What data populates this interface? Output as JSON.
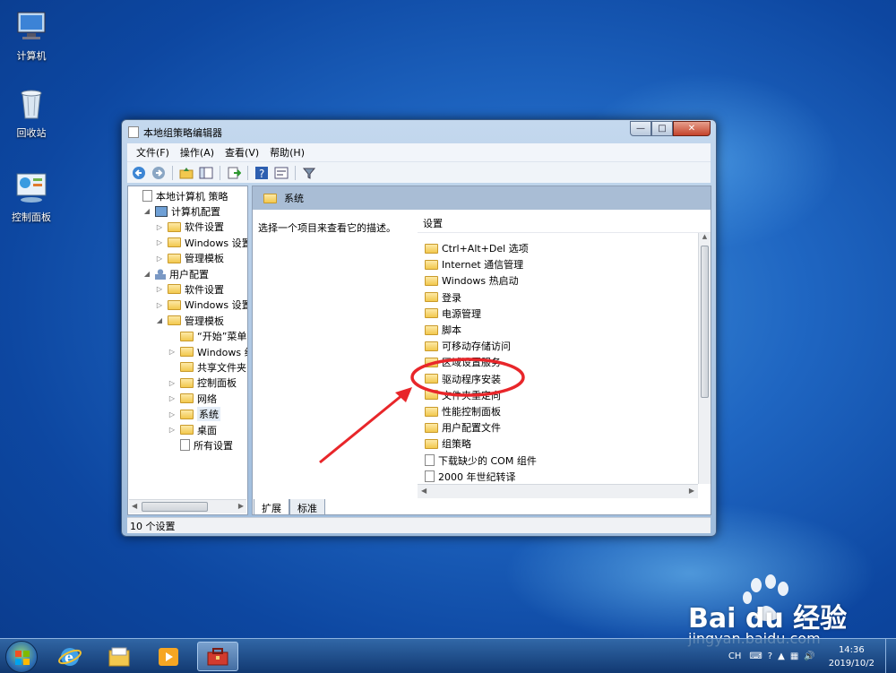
{
  "desktop": {
    "icons": [
      {
        "label": "计算机",
        "icon": "computer-icon"
      },
      {
        "label": "回收站",
        "icon": "recycle-bin-icon"
      },
      {
        "label": "控制面板",
        "icon": "control-panel-icon"
      }
    ]
  },
  "window": {
    "title": "本地组策略编辑器",
    "menu": [
      "文件(F)",
      "操作(A)",
      "查看(V)",
      "帮助(H)"
    ],
    "toolbar_icons": [
      "back-icon",
      "forward-icon",
      "up-folder-icon",
      "show-hide-tree-icon",
      "export-icon",
      "help-icon",
      "properties-icon",
      "filter-icon"
    ],
    "tree": [
      {
        "label": "本地计算机 策略",
        "indent": 0,
        "twisty": "",
        "icon": "doc"
      },
      {
        "label": "计算机配置",
        "indent": 1,
        "twisty": "◢",
        "icon": "pc"
      },
      {
        "label": "软件设置",
        "indent": 2,
        "twisty": "▷",
        "icon": "folder"
      },
      {
        "label": "Windows 设置",
        "indent": 2,
        "twisty": "▷",
        "icon": "folder"
      },
      {
        "label": "管理模板",
        "indent": 2,
        "twisty": "▷",
        "icon": "folder"
      },
      {
        "label": "用户配置",
        "indent": 1,
        "twisty": "◢",
        "icon": "user"
      },
      {
        "label": "软件设置",
        "indent": 2,
        "twisty": "▷",
        "icon": "folder"
      },
      {
        "label": "Windows 设置",
        "indent": 2,
        "twisty": "▷",
        "icon": "folder"
      },
      {
        "label": "管理模板",
        "indent": 2,
        "twisty": "◢",
        "icon": "folder"
      },
      {
        "label": "“开始”菜单",
        "indent": 3,
        "twisty": "",
        "icon": "folder"
      },
      {
        "label": "Windows 组",
        "indent": 3,
        "twisty": "▷",
        "icon": "folder"
      },
      {
        "label": "共享文件夹",
        "indent": 3,
        "twisty": "",
        "icon": "folder"
      },
      {
        "label": "控制面板",
        "indent": 3,
        "twisty": "▷",
        "icon": "folder"
      },
      {
        "label": "网络",
        "indent": 3,
        "twisty": "▷",
        "icon": "folder"
      },
      {
        "label": "系统",
        "indent": 3,
        "twisty": "▷",
        "icon": "folder",
        "selected": true
      },
      {
        "label": "桌面",
        "indent": 3,
        "twisty": "▷",
        "icon": "folder"
      },
      {
        "label": "所有设置",
        "indent": 3,
        "twisty": "",
        "icon": "doc"
      }
    ],
    "right": {
      "header": "系统",
      "description": "选择一个项目来查看它的描述。",
      "list_header": "设置",
      "items": [
        {
          "label": "Ctrl+Alt+Del 选项",
          "icon": "folder"
        },
        {
          "label": "Internet 通信管理",
          "icon": "folder"
        },
        {
          "label": "Windows 热启动",
          "icon": "folder"
        },
        {
          "label": "登录",
          "icon": "folder"
        },
        {
          "label": "电源管理",
          "icon": "folder"
        },
        {
          "label": "脚本",
          "icon": "folder"
        },
        {
          "label": "可移动存储访问",
          "icon": "folder"
        },
        {
          "label": "区域设置服务",
          "icon": "folder"
        },
        {
          "label": "驱动程序安装",
          "icon": "folder"
        },
        {
          "label": "文件夹重定向",
          "icon": "folder"
        },
        {
          "label": "性能控制面板",
          "icon": "folder"
        },
        {
          "label": "用户配置文件",
          "icon": "folder"
        },
        {
          "label": "组策略",
          "icon": "folder"
        },
        {
          "label": "下载缺少的 COM 组件",
          "icon": "doc"
        },
        {
          "label": "2000 年世纪转译",
          "icon": "doc"
        }
      ]
    },
    "tabs": [
      "扩展",
      "标准"
    ],
    "status": "10 个设置"
  },
  "taskbar": {
    "apps": [
      "internet-explorer-icon",
      "explorer-folder-icon",
      "media-player-icon",
      "policy-editor-icon"
    ],
    "tray": {
      "lang": "CH",
      "time": "14:36",
      "date": "2019/10/2"
    }
  },
  "watermark": {
    "brand": "Bai du 经验",
    "url": "jingyan.baidu.com"
  }
}
